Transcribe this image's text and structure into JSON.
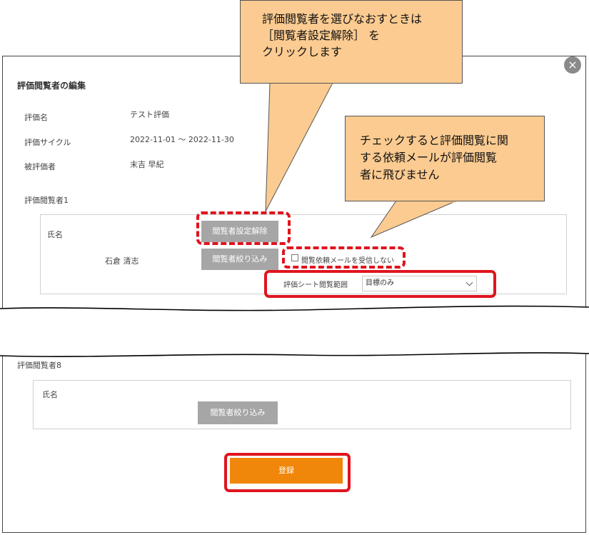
{
  "modal": {
    "title": "評価閲覧者の編集",
    "close_icon": "×"
  },
  "info": {
    "eval_name_label": "評価名",
    "eval_name_value": "テスト評価",
    "cycle_label": "評価サイクル",
    "cycle_value": "2022-11-01 ～ 2022-11-30",
    "evaluatee_label": "被評価者",
    "evaluatee_value": "末吉 早紀"
  },
  "viewer1": {
    "heading": "評価閲覧者1",
    "name_label": "氏名",
    "name_value": "石倉 清志",
    "release_button": "閲覧者設定解除",
    "filter_button": "閲覧者絞り込み",
    "no_mail_label": "閲覧依頼メールを受信しない",
    "no_mail_checked": false,
    "range_label": "評価シート閲覧範囲",
    "range_selected": "目標のみ"
  },
  "viewer8": {
    "heading": "評価閲覧者8",
    "name_label": "氏名",
    "filter_button": "閲覧者絞り込み"
  },
  "register_button": "登録",
  "callouts": {
    "top": {
      "line1": "評価閲覧者を選びなおすときは",
      "line2": "［閲覧者設定解除］ を",
      "line3": "クリックします"
    },
    "right": {
      "line1": "チェックすると評価閲覧に関",
      "line2": "する依頼メールが評価閲覧",
      "line3": "者に飛びません"
    }
  },
  "colors": {
    "accent": "#f0860a",
    "highlight": "#e0141e",
    "callout_fill": "#fbcb91",
    "button_gray": "#a6a6a6"
  }
}
